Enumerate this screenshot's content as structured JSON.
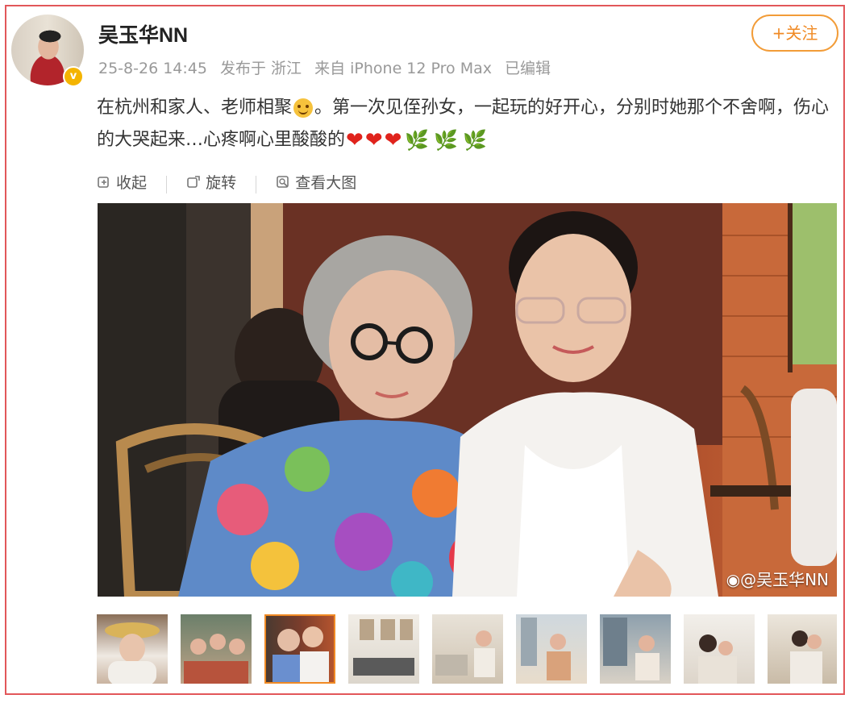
{
  "post": {
    "username": "吴玉华NN",
    "badge": "v",
    "time": "25-8-26 14:45",
    "location": "发布于 浙江",
    "source": "来自 iPhone 12 Pro Max",
    "edited": "已编辑",
    "follow_label": "+关注",
    "text_part1": "在杭州和家人、老师相聚",
    "text_part2": "。第一次见侄孙女，一起玩的好开心，分别时她那个不舍啊，伤心的大哭起来…心疼啊心里酸酸的"
  },
  "toolbar": {
    "collapse": "收起",
    "rotate": "旋转",
    "view_large": "查看大图"
  },
  "photo": {
    "watermark": "@吴玉华NN"
  },
  "emoji": {
    "smile": "smile-face-icon",
    "heart": "red-heart-icon",
    "leaf": "green-leaf-icon"
  },
  "colors": {
    "follow": "#f08a24",
    "border": "#e2575a",
    "meta": "#999999"
  },
  "thumbnails": {
    "count": 9,
    "active_index": 2
  }
}
